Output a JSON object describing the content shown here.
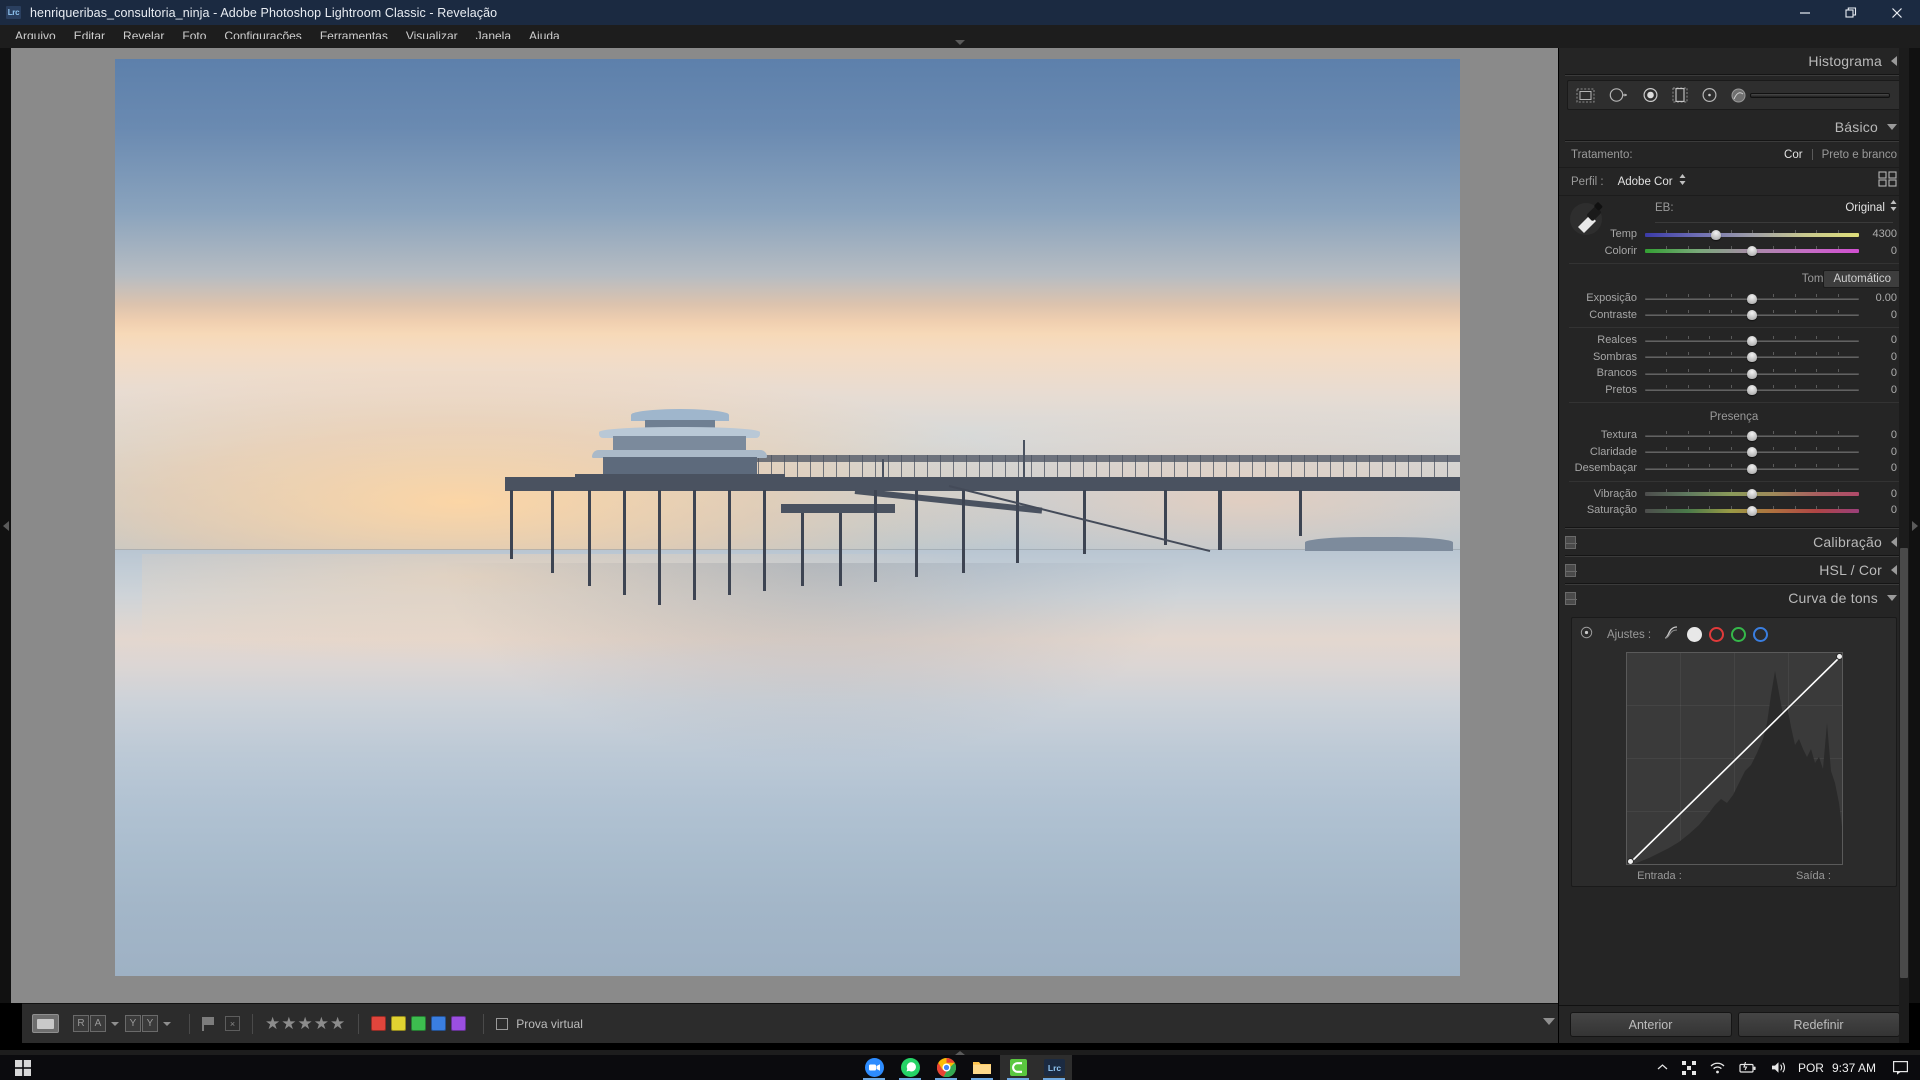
{
  "window": {
    "app_badge": "Lrc",
    "title": "henriqueribas_consultoria_ninja - Adobe Photoshop Lightroom Classic - Revelação",
    "minimize_label": "minimize-icon",
    "restore_label": "restore-icon",
    "close_label": "close-icon"
  },
  "menubar": {
    "items": [
      {
        "label": "Arquivo"
      },
      {
        "label": "Editar"
      },
      {
        "label": "Revelar"
      },
      {
        "label": "Foto"
      },
      {
        "label": "Configurações"
      },
      {
        "label": "Ferramentas"
      },
      {
        "label": "Visualizar"
      },
      {
        "label": "Janela"
      },
      {
        "label": "Ajuda"
      }
    ]
  },
  "histogram": {
    "title": "Histograma",
    "tools": [
      {
        "name": "crop-overlay-icon"
      },
      {
        "name": "spot-removal-icon"
      },
      {
        "name": "red-eye-icon"
      },
      {
        "name": "graduated-filter-icon"
      },
      {
        "name": "radial-filter-icon"
      },
      {
        "name": "masking-brush-icon"
      }
    ]
  },
  "basic": {
    "title": "Básico",
    "treatment_label": "Tratamento:",
    "treatment_color": "Cor",
    "treatment_bw": "Preto e branco",
    "profile_label": "Perfil :",
    "profile_value": "Adobe Cor",
    "wb_label": "EB:",
    "wb_value": "Original",
    "tone_label": "Tom",
    "auto_label": "Automático",
    "presence_label": "Presença",
    "sliders": [
      {
        "name": "Temp",
        "value": "4300",
        "pos": 33,
        "grad": "grad-temp"
      },
      {
        "name": "Colorir",
        "value": "0",
        "pos": 50,
        "grad": "grad-tint"
      },
      {
        "name": "Exposição",
        "value": "0.00",
        "pos": 50,
        "grad": ""
      },
      {
        "name": "Contraste",
        "value": "0",
        "pos": 50,
        "grad": ""
      },
      {
        "name": "Realces",
        "value": "0",
        "pos": 50,
        "grad": ""
      },
      {
        "name": "Sombras",
        "value": "0",
        "pos": 50,
        "grad": ""
      },
      {
        "name": "Brancos",
        "value": "0",
        "pos": 50,
        "grad": ""
      },
      {
        "name": "Pretos",
        "value": "0",
        "pos": 50,
        "grad": ""
      },
      {
        "name": "Textura",
        "value": "0",
        "pos": 50,
        "grad": ""
      },
      {
        "name": "Claridade",
        "value": "0",
        "pos": 50,
        "grad": ""
      },
      {
        "name": "Desembaçar",
        "value": "0",
        "pos": 50,
        "grad": ""
      },
      {
        "name": "Vibração",
        "value": "0",
        "pos": 50,
        "grad": "grad-vib"
      },
      {
        "name": "Saturação",
        "value": "0",
        "pos": 50,
        "grad": "grad-sat"
      }
    ]
  },
  "panels": {
    "calibration": "Calibração",
    "hsl_color": "HSL / Cor",
    "tone_curve": "Curva de tons"
  },
  "tone_curve": {
    "adjust_label": "Ajustes :",
    "input_label": "Entrada :",
    "output_label": "Saída :",
    "channels": [
      {
        "name": "parametric-curve-icon",
        "color": "#c9c9c9"
      },
      {
        "name": "rgb-channel-icon",
        "color": "#e8e8e8"
      },
      {
        "name": "red-channel-icon",
        "color": "#e03a3a"
      },
      {
        "name": "green-channel-icon",
        "color": "#35b84a"
      },
      {
        "name": "blue-channel-icon",
        "color": "#3a7ee0"
      }
    ]
  },
  "panel_buttons": {
    "previous": "Anterior",
    "reset": "Redefinir"
  },
  "toolbar": {
    "view_mode": "loupe-view-icon",
    "before_after_left": "R",
    "before_after_right": "A",
    "copy_left": "Y",
    "copy_right": "Y",
    "flag_icon": "flag-icon",
    "reject_icon": "reject-flag-icon",
    "stars": "★★★★★",
    "star_count": 5,
    "color_labels": [
      {
        "name": "red-label",
        "hex": "#e0453c"
      },
      {
        "name": "yellow-label",
        "hex": "#e0d231"
      },
      {
        "name": "green-label",
        "hex": "#3dbd4f"
      },
      {
        "name": "blue-label",
        "hex": "#3a7ee0"
      },
      {
        "name": "purple-label",
        "hex": "#9b4fe0"
      }
    ],
    "soft_proof_label": "Prova virtual",
    "soft_proof_checked": false
  },
  "taskbar": {
    "start_label": "windows-start-icon",
    "apps": [
      {
        "name": "zoom-app-icon",
        "hex": "#2d8cff",
        "active": false,
        "running": true
      },
      {
        "name": "whatsapp-app-icon",
        "hex": "#25d366",
        "active": false,
        "running": true
      },
      {
        "name": "chrome-app-icon",
        "hex": "#ea4335",
        "active": false,
        "running": true
      },
      {
        "name": "file-explorer-icon",
        "hex": "#ffc44d",
        "active": false,
        "running": true
      },
      {
        "name": "camtasia-app-icon",
        "hex": "#5ac73f",
        "active": true,
        "running": true
      },
      {
        "name": "lightroom-app-icon",
        "hex": "#2a3f5f",
        "active": true,
        "running": true
      }
    ],
    "tray": [
      {
        "name": "show-hidden-icons-chevron"
      },
      {
        "name": "screen-capture-icon"
      },
      {
        "name": "wifi-icon"
      },
      {
        "name": "battery-icon"
      },
      {
        "name": "volume-icon"
      }
    ],
    "language": "POR",
    "clock": "9:37 AM",
    "action_center": "notification-icon"
  }
}
